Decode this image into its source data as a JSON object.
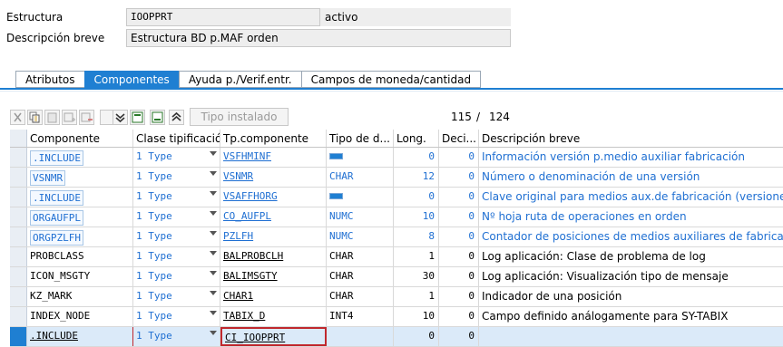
{
  "header": {
    "estructura_label": "Estructura",
    "estructura_value": "IOOPPRT",
    "estado": "activo",
    "descripcion_label": "Descripción breve",
    "descripcion_value": "Estructura BD p.MAF orden"
  },
  "tabs": [
    {
      "label": "Atributos",
      "active": false
    },
    {
      "label": "Componentes",
      "active": true
    },
    {
      "label": "Ayuda p./Verif.entr.",
      "active": false
    },
    {
      "label": "Campos de moneda/cantidad",
      "active": false
    }
  ],
  "toolbar": {
    "icons": [
      "cut-icon",
      "copy-icon",
      "paste-icon",
      "insert-row-icon",
      "delete-row-icon",
      "collapse-icon",
      "first-page-icon",
      "last-page-icon",
      "expand-icon"
    ],
    "tipo_instalado_label": "Tipo instalado",
    "counter_current": "115",
    "counter_sep": "/",
    "counter_total": "124"
  },
  "table": {
    "columns": [
      "Componente",
      "Clase tipificación",
      "Tp.componente",
      "Tipo de d...",
      "Long.",
      "Deci...",
      "Descripción breve"
    ],
    "rows": [
      {
        "comp": ".INCLUDE",
        "clase": "1 Type",
        "tp": "VSFHMINF",
        "tipo": "",
        "long": "0",
        "dec": "0",
        "desc": "Información versión p.medio auxiliar fabricación"
      },
      {
        "comp": "VSNMR",
        "clase": "1 Type",
        "tp": "VSNMR",
        "tipo": "CHAR",
        "long": "12",
        "dec": "0",
        "desc": "Número o denominación de una versión"
      },
      {
        "comp": ".INCLUDE",
        "clase": "1 Type",
        "tp": "VSAFFHORG",
        "tipo": "",
        "long": "0",
        "dec": "0",
        "desc": "Clave original para medios aux.de fabricación (versiones)"
      },
      {
        "comp": "ORGAUFPL",
        "clase": "1 Type",
        "tp": "CO_AUFPL",
        "tipo": "NUMC",
        "long": "10",
        "dec": "0",
        "desc": "Nº hoja ruta de operaciones en orden"
      },
      {
        "comp": "ORGPZLFH",
        "clase": "1 Type",
        "tp": "PZLFH",
        "tipo": "NUMC",
        "long": "8",
        "dec": "0",
        "desc": "Contador de posiciones de medios auxiliares de fabricación"
      },
      {
        "comp": "PROBCLASS",
        "clase": "1 Type",
        "tp": "BALPROBCLH",
        "tipo": "CHAR",
        "long": "1",
        "dec": "0",
        "desc": "Log aplicación: Clase de problema de log"
      },
      {
        "comp": "ICON_MSGTY",
        "clase": "1 Type",
        "tp": "BALIMSGTY",
        "tipo": "CHAR",
        "long": "30",
        "dec": "0",
        "desc": "Log aplicación: Visualización tipo de mensaje"
      },
      {
        "comp": "KZ_MARK",
        "clase": "1 Type",
        "tp": "CHAR1",
        "tipo": "CHAR",
        "long": "1",
        "dec": "0",
        "desc": "Indicador de una posición"
      },
      {
        "comp": "INDEX_NODE",
        "clase": "1 Type",
        "tp": "TABIX_D",
        "tipo": "INT4",
        "long": "10",
        "dec": "0",
        "desc": "Campo definido análogamente para SY-TABIX"
      },
      {
        "comp": ".INCLUDE",
        "clase": "1 Type",
        "tp": "CI_IOOPPRT",
        "tipo": "",
        "long": "0",
        "dec": "0",
        "desc": ""
      }
    ]
  },
  "colors": {
    "accent": "#1f7fd2",
    "link": "#1f6fd2",
    "highlight": "#c0282d"
  }
}
